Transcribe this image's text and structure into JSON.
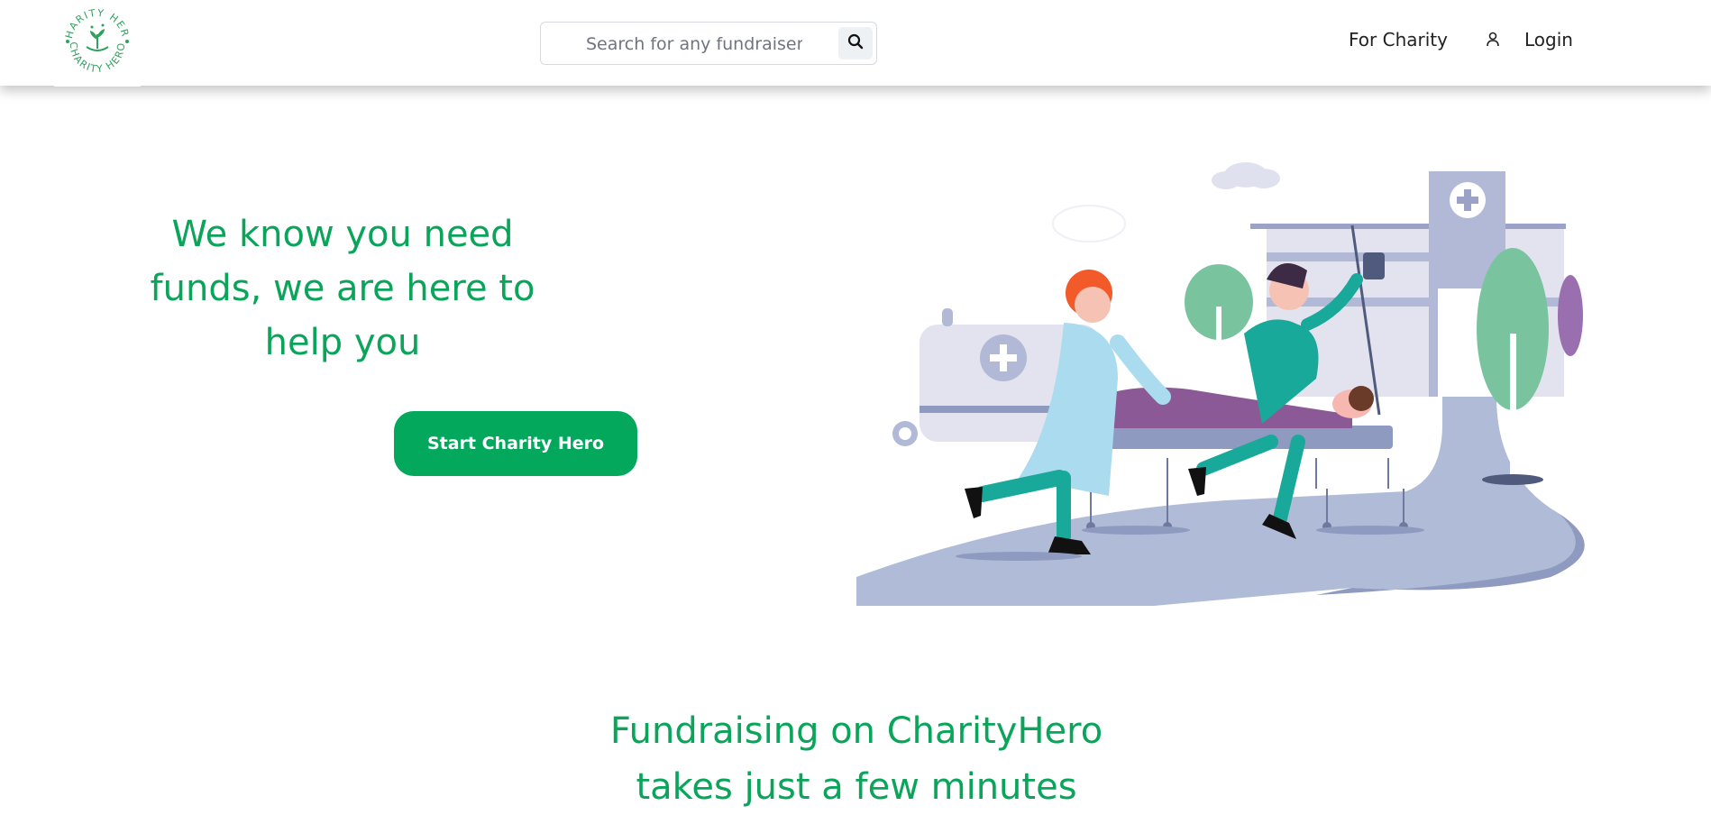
{
  "header": {
    "logo_text": "CHARITY HERO",
    "search": {
      "placeholder": "Search for any fundraiser",
      "value": ""
    },
    "nav": {
      "for_charity": "For Charity",
      "login": "Login"
    }
  },
  "hero": {
    "title_lines": [
      "We know you need",
      "funds, we are here to",
      "help you"
    ],
    "cta_label": "Start Charity Hero"
  },
  "section": {
    "title_lines": [
      "Fundraising on CharityHero",
      "takes just a few minutes"
    ]
  },
  "colors": {
    "brand_green": "#0aa55a",
    "button_green": "#03a85d",
    "road": "#b0bbd8"
  },
  "icons": [
    "search-icon",
    "user-icon"
  ]
}
